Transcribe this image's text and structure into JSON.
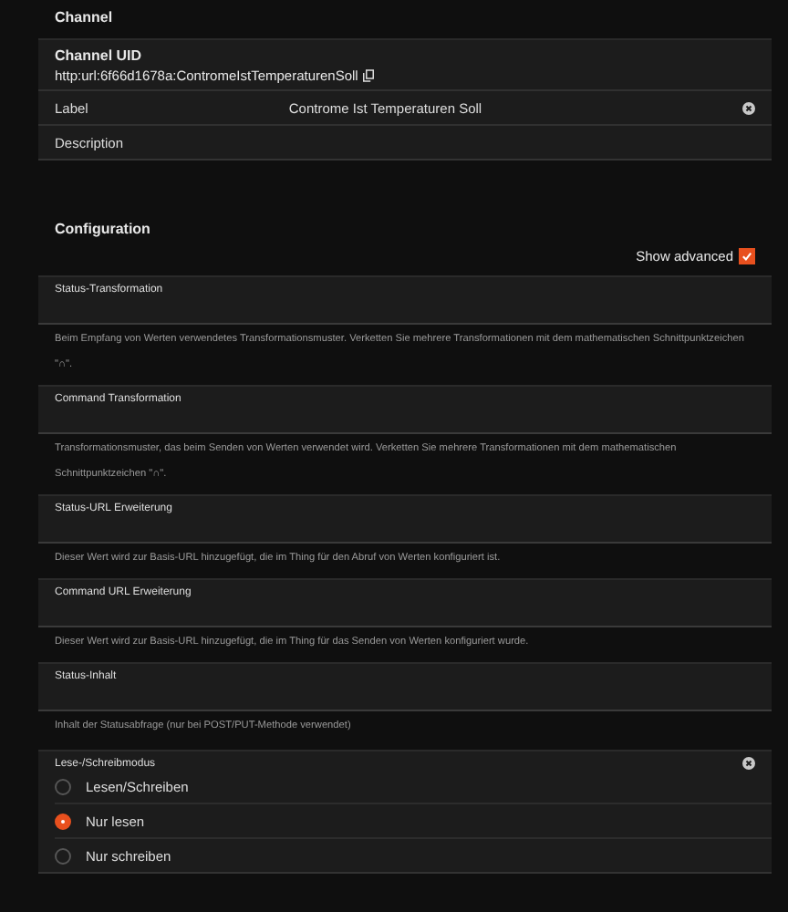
{
  "channel": {
    "title": "Channel",
    "uid_label": "Channel UID",
    "uid": "http:url:6f66d1678a:ContromeIstTemperaturenSoll",
    "label_field": {
      "label": "Label",
      "value": "Controme Ist Temperaturen Soll"
    },
    "description_label": "Description"
  },
  "configuration": {
    "title": "Configuration",
    "show_advanced": {
      "label": "Show advanced",
      "checked": true
    },
    "params": [
      {
        "label": "Status-Transformation",
        "description": "Beim Empfang von Werten verwendetes Transformationsmuster. Verketten Sie mehrere Transformationen mit dem mathematischen Schnittpunktzeichen \"∩\"."
      },
      {
        "label": "Command Transformation",
        "description": "Transformationsmuster, das beim Senden von Werten verwendet wird. Verketten Sie mehrere Transformationen mit dem mathematischen Schnittpunktzeichen \"∩\"."
      },
      {
        "label": "Status-URL Erweiterung",
        "description": "Dieser Wert wird zur Basis-URL hinzugefügt, die im Thing für den Abruf von Werten konfiguriert ist."
      },
      {
        "label": "Command URL Erweiterung",
        "description": "Dieser Wert wird zur Basis-URL hinzugefügt, die im Thing für das Senden von Werten konfiguriert wurde."
      },
      {
        "label": "Status-Inhalt",
        "description": "Inhalt der Statusabfrage (nur bei POST/PUT-Methode verwendet)"
      }
    ],
    "access_mode": {
      "label": "Lese-/Schreibmodus",
      "options": [
        {
          "label": "Lesen/Schreiben",
          "selected": false
        },
        {
          "label": "Nur lesen",
          "selected": true
        },
        {
          "label": "Nur schreiben",
          "selected": false
        }
      ]
    }
  }
}
